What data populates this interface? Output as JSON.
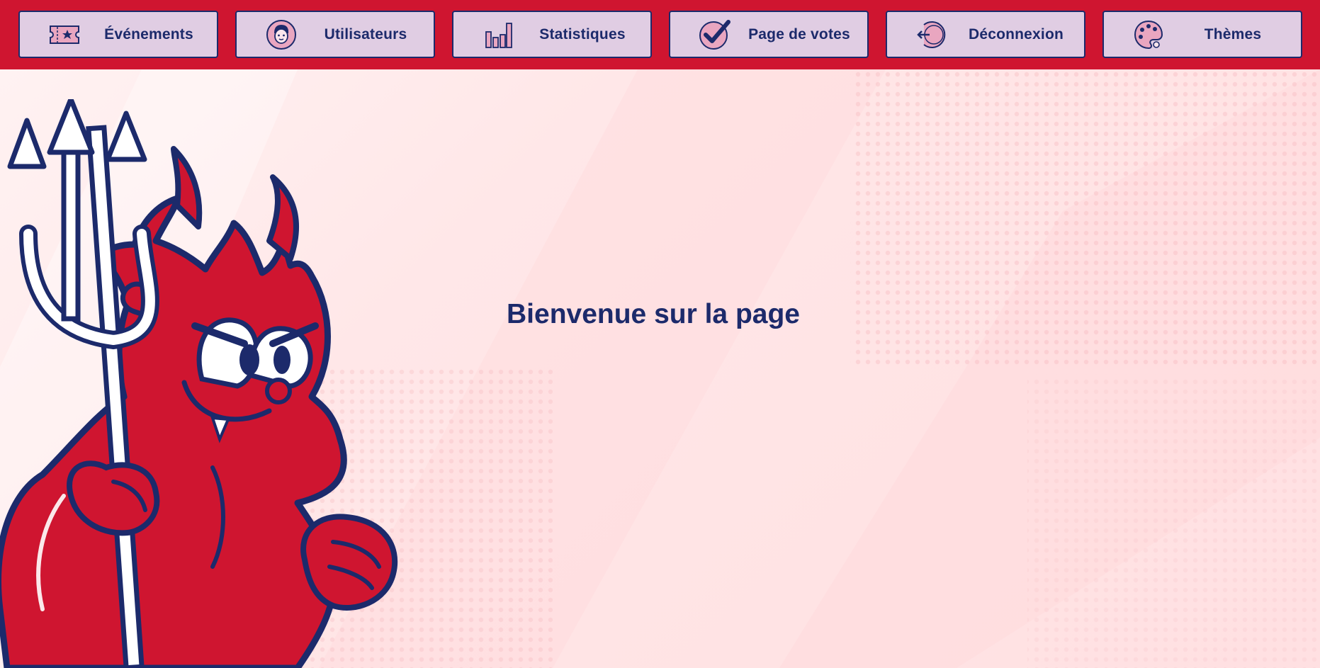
{
  "nav": {
    "items": [
      {
        "label": "Événements",
        "icon": "ticket-icon"
      },
      {
        "label": "Utilisateurs",
        "icon": "user-face-icon"
      },
      {
        "label": "Statistiques",
        "icon": "bar-chart-icon"
      },
      {
        "label": "Page de votes",
        "icon": "checkmark-icon"
      },
      {
        "label": "Déconnexion",
        "icon": "logout-icon"
      },
      {
        "label": "Thèmes",
        "icon": "palette-icon"
      }
    ]
  },
  "main": {
    "welcome_text": "Bienvenue sur la page",
    "mascot": "devil-mascot-with-trident"
  },
  "colors": {
    "navbar": "#cf1530",
    "button_bg": "#e0cde3",
    "navy": "#1c2a6b",
    "mascot_red": "#cf1530",
    "background": "#ffe4e5"
  }
}
